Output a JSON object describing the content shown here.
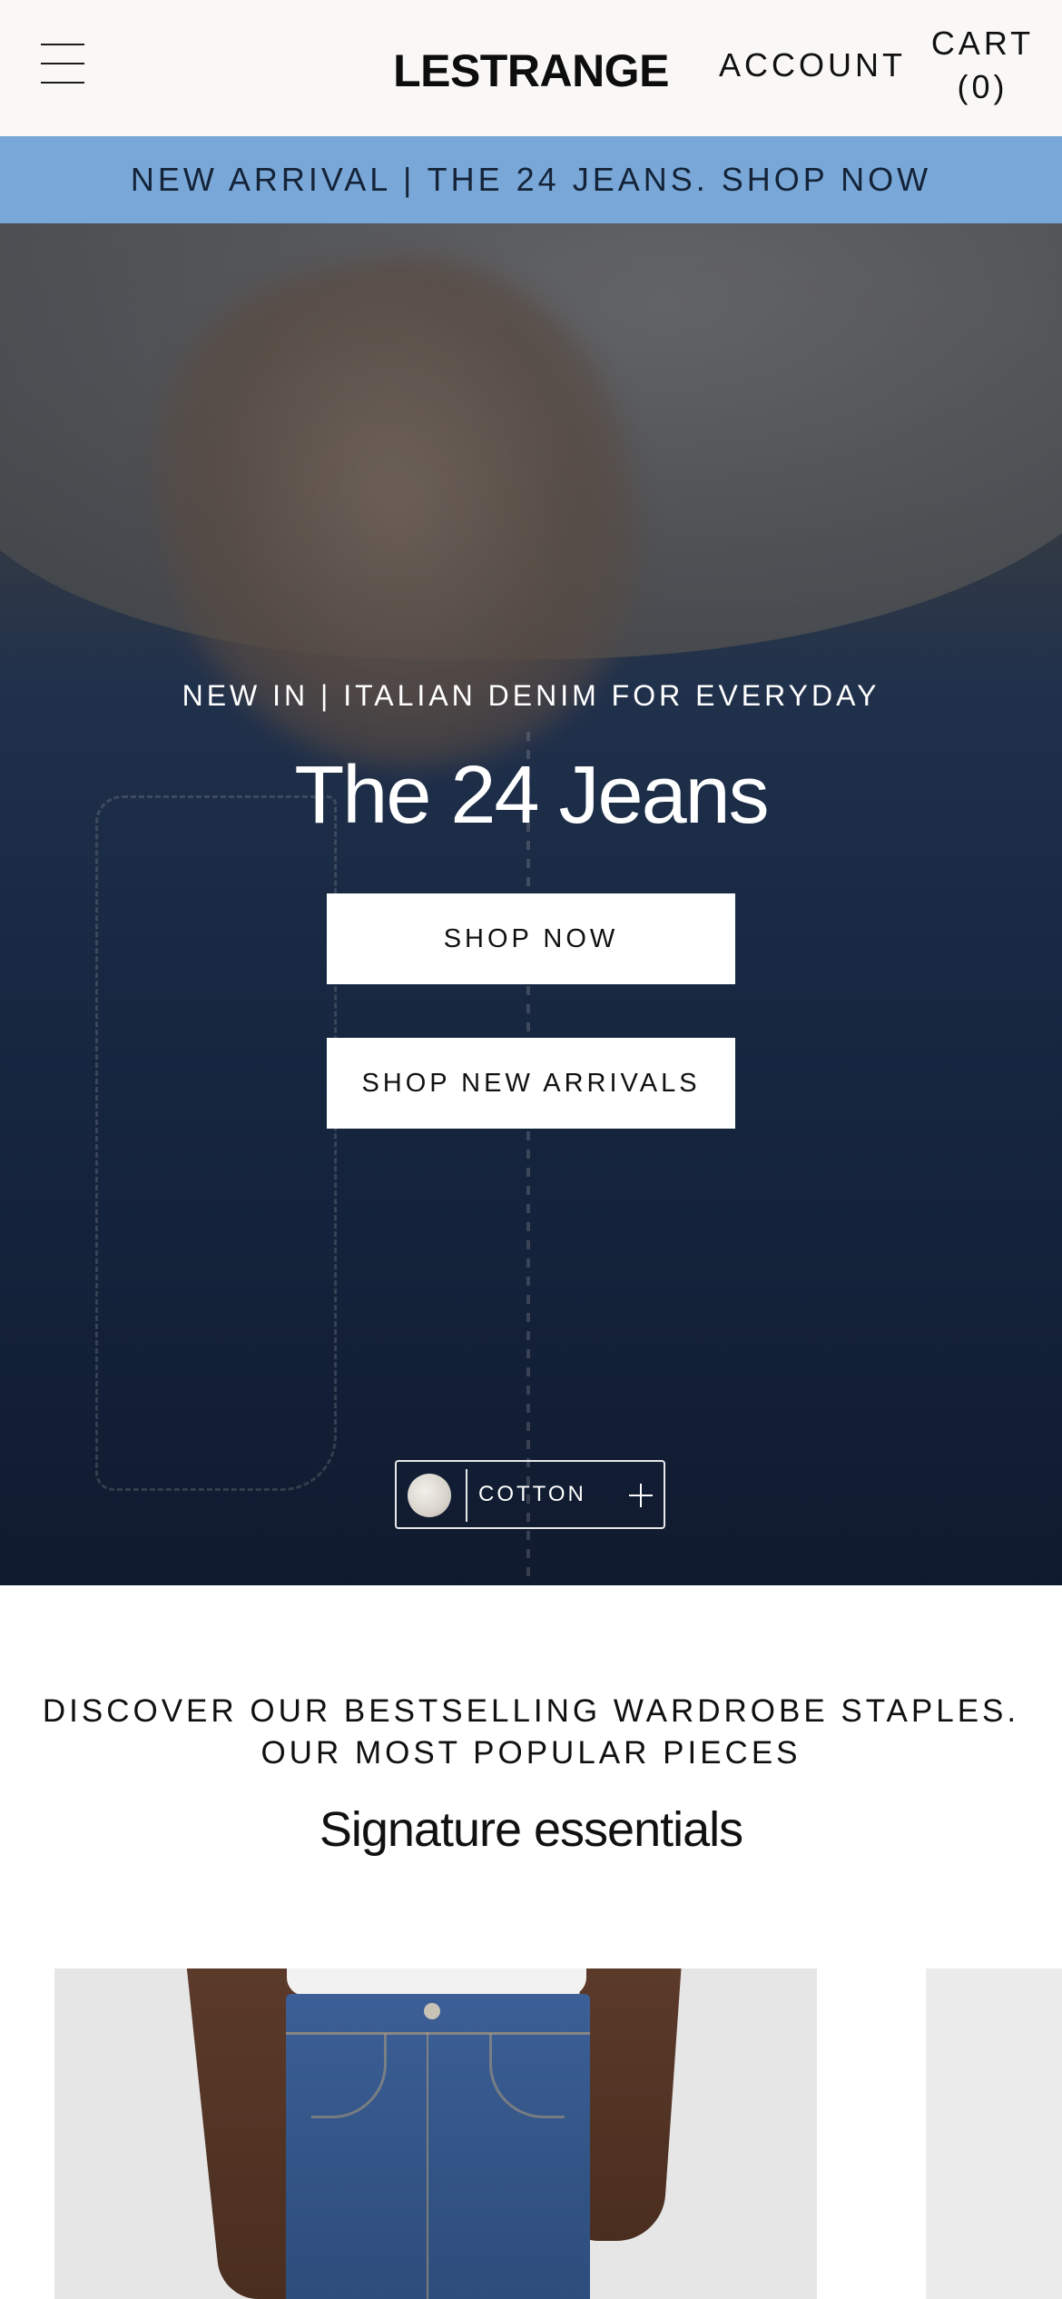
{
  "header": {
    "logo": "LESTRANGE",
    "account_label": "ACCOUNT",
    "cart_label": "CART",
    "cart_count": "(0)"
  },
  "announcement": {
    "text": "NEW ARRIVAL | THE 24 JEANS. SHOP NOW",
    "background": "#79a8d8"
  },
  "hero": {
    "eyebrow": "NEW IN | ITALIAN DENIM FOR EVERYDAY",
    "title": "The 24 Jeans",
    "buttons": [
      {
        "label": "SHOP NOW"
      },
      {
        "label": "SHOP NEW ARRIVALS"
      }
    ],
    "fabric_tag": {
      "label": "COTTON",
      "icon": "plus-icon"
    }
  },
  "bestsellers": {
    "eyebrow": "DISCOVER OUR BESTSELLING WARDROBE STAPLES. OUR MOST POPULAR PIECES",
    "title": "Signature essentials"
  },
  "icons": {
    "menu": "hamburger-menu-icon",
    "fabric_expand": "plus-icon"
  }
}
